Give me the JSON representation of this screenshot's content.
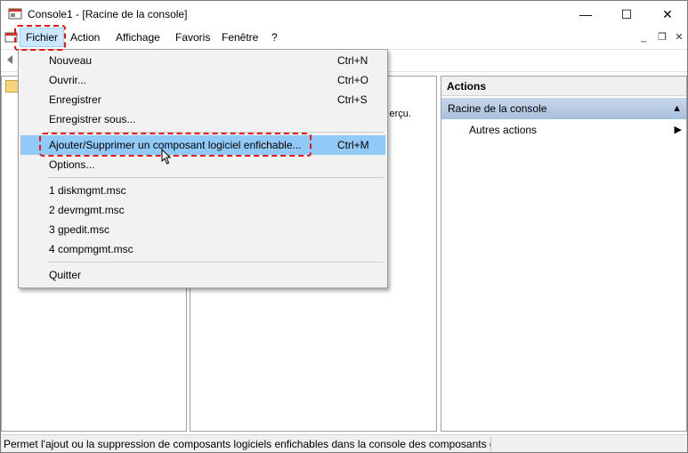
{
  "window": {
    "title": "Console1 - [Racine de la console]",
    "min_glyph": "—",
    "max_glyph": "☐",
    "close_glyph": "✕"
  },
  "menubar": {
    "fichier": "Fichier",
    "action": "Action",
    "affichage": "Affichage",
    "favoris": "Favoris",
    "fenetre": "Fenêtre",
    "help": "?",
    "mdi_min": "_",
    "mdi_restore": "❐",
    "mdi_close": "✕"
  },
  "dropdown": {
    "items": [
      {
        "label": "Nouveau",
        "shortcut": "Ctrl+N"
      },
      {
        "label": "Ouvrir...",
        "shortcut": "Ctrl+O"
      },
      {
        "label": "Enregistrer",
        "shortcut": "Ctrl+S"
      },
      {
        "label": "Enregistrer sous...",
        "shortcut": ""
      },
      {
        "label": "Ajouter/Supprimer un composant logiciel enfichable...",
        "shortcut": "Ctrl+M"
      },
      {
        "label": "Options...",
        "shortcut": ""
      },
      {
        "label": "1 diskmgmt.msc",
        "shortcut": ""
      },
      {
        "label": "2 devmgmt.msc",
        "shortcut": ""
      },
      {
        "label": "3 gpedit.msc",
        "shortcut": ""
      },
      {
        "label": "4 compmgmt.msc",
        "shortcut": ""
      },
      {
        "label": "Quitter",
        "shortcut": ""
      }
    ]
  },
  "center": {
    "partial_text": "erçu."
  },
  "actions": {
    "header": "Actions",
    "root_label": "Racine de la console",
    "more_label": "Autres actions",
    "arrow_up": "▲",
    "arrow_right": "▶"
  },
  "status": {
    "text": "Permet l'ajout ou la suppression de composants logiciels enfichables dans la console des composants er"
  },
  "colors": {
    "highlight_red": "#e8141c",
    "menu_hover": "#91c9f7",
    "actions_selected": "#b6cbe4"
  },
  "icons": {
    "app": "console-app-icon",
    "back": "back-arrow-icon",
    "folder": "folder-icon",
    "cursor": "mouse-cursor-icon"
  }
}
